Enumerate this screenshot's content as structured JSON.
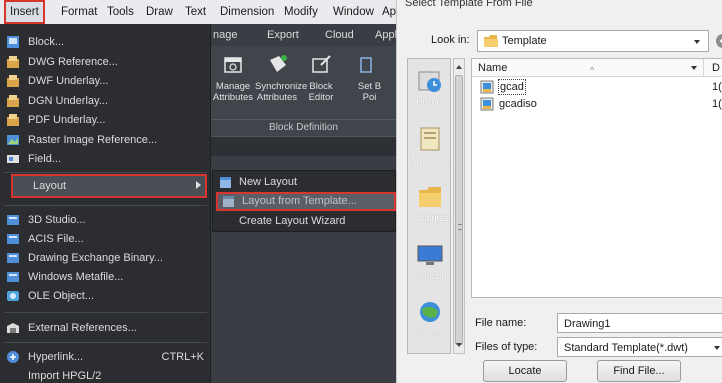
{
  "menubar": {
    "items": [
      "Insert",
      "Format",
      "Tools",
      "Draw",
      "Text",
      "Dimension",
      "Modify",
      "Window",
      "Ap"
    ]
  },
  "ribbon": {
    "tabs": [
      "nage",
      "Export",
      "Cloud",
      "Appl"
    ],
    "buttons": [
      {
        "label": "Manage\nAttributes"
      },
      {
        "label": "Synchronize\nAttributes"
      },
      {
        "label": "Block\nEditor"
      },
      {
        "label": "Set B\nPoi"
      }
    ],
    "group_label": "Block Definition"
  },
  "insert_menu": {
    "items": [
      {
        "label": "Block...",
        "icon": "block-icon"
      },
      {
        "label": "DWG Reference...",
        "icon": "dwg-reference-icon"
      },
      {
        "label": "DWF Underlay...",
        "icon": "dwf-underlay-icon"
      },
      {
        "label": "DGN Underlay...",
        "icon": "dgn-underlay-icon"
      },
      {
        "label": "PDF Underlay...",
        "icon": "pdf-underlay-icon"
      },
      {
        "label": "Raster Image Reference...",
        "icon": "raster-image-icon"
      },
      {
        "label": "Field...",
        "icon": "field-icon"
      },
      {
        "label": "Layout",
        "icon": ""
      },
      {
        "label": "3D Studio...",
        "icon": "3d-studio-icon"
      },
      {
        "label": "ACIS File...",
        "icon": "acis-file-icon"
      },
      {
        "label": "Drawing Exchange Binary...",
        "icon": "dxb-icon"
      },
      {
        "label": "Windows Metafile...",
        "icon": "wmf-icon"
      },
      {
        "label": "OLE Object...",
        "icon": "ole-object-icon"
      },
      {
        "label": "External References...",
        "icon": "external-references-icon"
      },
      {
        "label": "Hyperlink...",
        "icon": "hyperlink-icon",
        "shortcut": "CTRL+K"
      },
      {
        "label": "Import HPGL/2",
        "icon": ""
      }
    ]
  },
  "layout_submenu": {
    "items": [
      {
        "label": "New Layout"
      },
      {
        "label": "Layout from Template..."
      },
      {
        "label": "Create Layout Wizard"
      }
    ]
  },
  "dialog": {
    "title": "Select Template From File",
    "look_in_label": "Look in:",
    "look_in_value": "Template",
    "places": [
      "History",
      "My Doc...",
      "Favorites",
      "Desktop",
      "Network"
    ],
    "columns": [
      "Name",
      "D"
    ],
    "files": [
      {
        "name": "gcad",
        "date": "1("
      },
      {
        "name": "gcadiso",
        "date": "1("
      }
    ],
    "file_name_label": "File name:",
    "file_name_value": "Drawing1",
    "file_type_label": "Files of type:",
    "file_type_value": "Standard Template(*.dwt)",
    "locate_button": "Locate",
    "find_file_button": "Find File..."
  },
  "colors": {
    "highlight": "#d8352f",
    "menu_bg": "#2b2d31",
    "dialog_bg": "#f0f0f0"
  }
}
